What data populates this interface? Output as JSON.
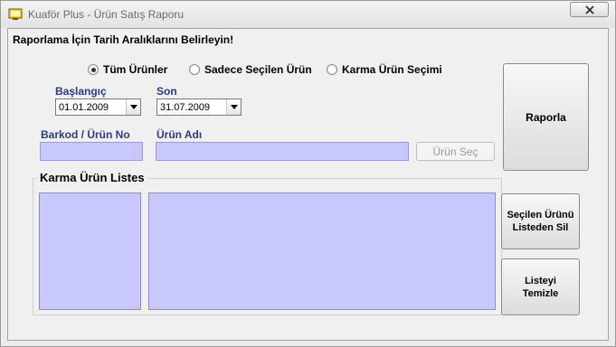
{
  "window": {
    "title": "Kuaför Plus - Ürün Satış Raporu",
    "close_label": "✕"
  },
  "header": {
    "instruction": "Raporlama İçin Tarih Aralıklarını Belirleyin!"
  },
  "filter": {
    "options": [
      {
        "label": "Tüm Ürünler",
        "selected": true
      },
      {
        "label": "Sadece Seçilen Ürün",
        "selected": false
      },
      {
        "label": "Karma Ürün Seçimi",
        "selected": false
      }
    ]
  },
  "dates": {
    "start_label": "Başlangıç",
    "start_value": "01.01.2009",
    "end_label": "Son",
    "end_value": "31.07.2009"
  },
  "product": {
    "barcode_label": "Barkod / Ürün No",
    "barcode_value": "",
    "name_label": "Ürün Adı",
    "name_value": "",
    "select_button": "Ürün Seç"
  },
  "buttons": {
    "report": "Raporla",
    "remove_selected_line1": "Seçilen Ürünü",
    "remove_selected_line2": "Listeden Sil",
    "clear_list_line1": "Listeyi",
    "clear_list_line2": "Temizle"
  },
  "mixed_list": {
    "title": "Karma Ürün Listes"
  },
  "colors": {
    "input_bg": "#c8c8ff",
    "label_blue": "#2c3a8c"
  }
}
